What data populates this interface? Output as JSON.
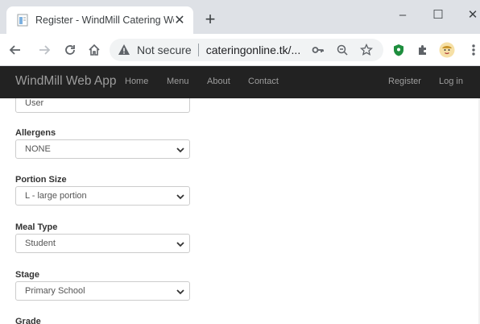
{
  "browser": {
    "tab_title": "Register - WindMill Catering Web App",
    "tab_close": "✕",
    "new_tab": "+",
    "window_controls": {
      "minimize": "–",
      "maximize": "☐",
      "close": "✕"
    },
    "security_label": "Not secure",
    "url": "cateringonline.tk/...",
    "icons": {
      "back": "arrow-left-icon",
      "forward": "arrow-right-icon",
      "reload": "reload-icon",
      "home": "home-icon",
      "key": "key-icon",
      "zoom": "zoom-icon",
      "star": "star-icon",
      "extension_shield": "shield-icon",
      "extensions": "puzzle-icon",
      "profile": "avatar-icon",
      "menu": "kebab-menu-icon"
    }
  },
  "navbar": {
    "brand": "WindMill Web App",
    "links": [
      "Home",
      "Menu",
      "About",
      "Contact"
    ],
    "right_links": [
      "Register",
      "Log in"
    ]
  },
  "form": {
    "partial_field_value": "User",
    "fields": [
      {
        "label": "Allergens",
        "value": "NONE"
      },
      {
        "label": "Portion Size",
        "value": "L - large portion"
      },
      {
        "label": "Meal Type",
        "value": "Student"
      },
      {
        "label": "Stage",
        "value": "Primary School"
      }
    ],
    "next_label": "Grade"
  },
  "colors": {
    "navbar_bg": "#222222",
    "navbar_text": "#9d9d9d",
    "tabstrip_bg": "#dee1e6"
  }
}
